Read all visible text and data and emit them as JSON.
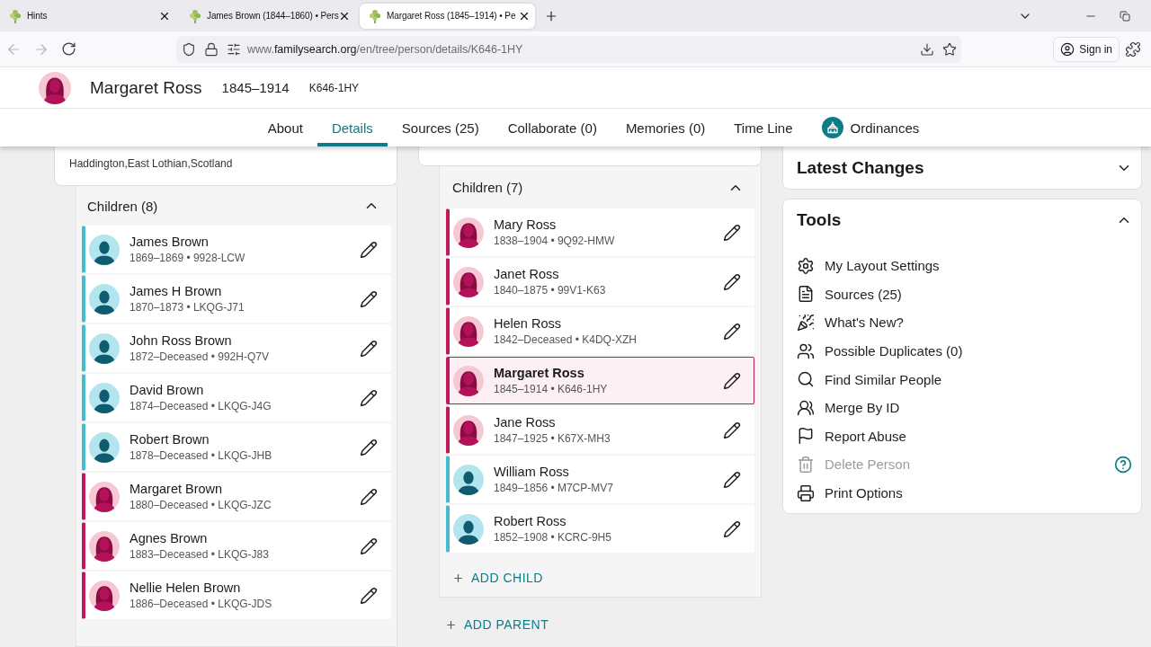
{
  "browser": {
    "tabs": [
      {
        "title": "Hints",
        "selected": false
      },
      {
        "title": "James Brown (1844–1860) • Pers",
        "selected": false
      },
      {
        "title": "Margaret Ross (1845–1914) • Pe",
        "selected": true
      }
    ],
    "url": {
      "prefix": "www.",
      "host": "familysearch.org",
      "path": "/en/tree/person/details/K646-1HY"
    },
    "sign_in": "Sign in"
  },
  "person": {
    "name": "Margaret Ross",
    "lifespan": "1845–1914",
    "id": "K646-1HY",
    "kind": "female"
  },
  "nav_tabs": [
    {
      "label": "About",
      "selected": false,
      "kind": "plain"
    },
    {
      "label": "Details",
      "selected": true,
      "kind": "plain"
    },
    {
      "label": "Sources (25)",
      "selected": false,
      "kind": "plain"
    },
    {
      "label": "Collaborate (0)",
      "selected": false,
      "kind": "plain"
    },
    {
      "label": "Memories (0)",
      "selected": false,
      "kind": "plain"
    },
    {
      "label": "Time Line",
      "selected": false,
      "kind": "plain"
    },
    {
      "label": "Ordinances",
      "selected": false,
      "kind": "ordinances"
    }
  ],
  "left_family": {
    "place": "Haddington,East Lothian,Scotland",
    "children_title": "Children (8)",
    "expanded": true,
    "children": [
      {
        "name": "James Brown",
        "details": "1869–1869 • 9928-LCW",
        "kind": "male",
        "selected": false
      },
      {
        "name": "James H Brown",
        "details": "1870–1873 • LKQG-J71",
        "kind": "male",
        "selected": false
      },
      {
        "name": "John Ross Brown",
        "details": "1872–Deceased • 992H-Q7V",
        "kind": "male",
        "selected": false
      },
      {
        "name": "David Brown",
        "details": "1874–Deceased • LKQG-J4G",
        "kind": "male",
        "selected": false
      },
      {
        "name": "Robert Brown",
        "details": "1878–Deceased • LKQG-JHB",
        "kind": "male",
        "selected": false
      },
      {
        "name": "Margaret Brown",
        "details": "1880–Deceased • LKQG-JZC",
        "kind": "female",
        "selected": false
      },
      {
        "name": "Agnes Brown",
        "details": "1883–Deceased • LKQG-J83",
        "kind": "female",
        "selected": false
      },
      {
        "name": "Nellie Helen Brown",
        "details": "1886–Deceased • LKQG-JDS",
        "kind": "female",
        "selected": false
      }
    ]
  },
  "middle_family": {
    "children_title": "Children (7)",
    "expanded": true,
    "children": [
      {
        "name": "Mary Ross",
        "details": "1838–1904 • 9Q92-HMW",
        "kind": "female",
        "selected": false
      },
      {
        "name": "Janet Ross",
        "details": "1840–1875 • 99V1-K63",
        "kind": "female",
        "selected": false
      },
      {
        "name": "Helen Ross",
        "details": "1842–Deceased • K4DQ-XZH",
        "kind": "female",
        "selected": false
      },
      {
        "name": "Margaret Ross",
        "details": "1845–1914 • K646-1HY",
        "kind": "female",
        "selected": true
      },
      {
        "name": "Jane Ross",
        "details": "1847–1925 • K67X-MH3",
        "kind": "female",
        "selected": false
      },
      {
        "name": "William Ross",
        "details": "1849–1856 • M7CP-MV7",
        "kind": "male",
        "selected": false
      },
      {
        "name": "Robert Ross",
        "details": "1852–1908 • KCRC-9H5",
        "kind": "male",
        "selected": false
      }
    ],
    "add_child": "ADD CHILD"
  },
  "add_parent": "ADD PARENT",
  "sidebar": {
    "latest_changes": {
      "title": "Latest Changes",
      "expanded": false
    },
    "tools": {
      "title": "Tools",
      "expanded": true,
      "items": [
        {
          "label": "My Layout Settings",
          "kind": "settings",
          "disabled": false
        },
        {
          "label": "Sources (25)",
          "kind": "sources",
          "disabled": false
        },
        {
          "label": "What's New?",
          "kind": "whats_new",
          "disabled": false
        },
        {
          "label": "Possible Duplicates (0)",
          "kind": "duplicates",
          "disabled": false
        },
        {
          "label": "Find Similar People",
          "kind": "find_similar",
          "disabled": false
        },
        {
          "label": "Merge By ID",
          "kind": "merge",
          "disabled": false
        },
        {
          "label": "Report Abuse",
          "kind": "report",
          "disabled": false
        },
        {
          "label": "Delete Person",
          "kind": "delete",
          "disabled": true
        },
        {
          "label": "Print Options",
          "kind": "print",
          "disabled": false
        }
      ]
    }
  }
}
